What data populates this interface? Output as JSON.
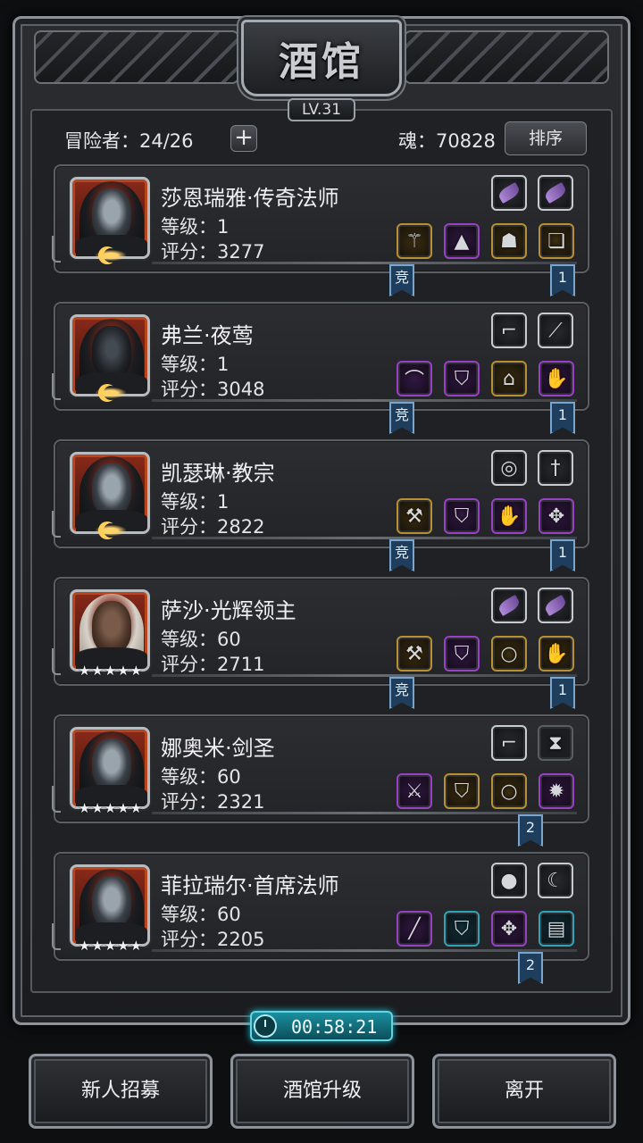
{
  "title": "酒馆",
  "level_badge": "LV.31",
  "header": {
    "adventurers": "冒险者：24/26",
    "plus": "+",
    "soul": "魂：70828",
    "sort_label": "排序"
  },
  "heroes": [
    {
      "name": "莎恩瑞雅·传奇法师",
      "level": "等级：1",
      "score": "评分：3277",
      "rank_marker": "moon",
      "portrait": "hooded-mage",
      "top_slots": [
        {
          "tier": "white",
          "icon": "gem-icon"
        },
        {
          "tier": "white",
          "icon": "gem-icon"
        }
      ],
      "bottom_slots": [
        {
          "tier": "gold",
          "icon": "staff-icon"
        },
        {
          "tier": "purple",
          "icon": "hat-icon"
        },
        {
          "tier": "gold",
          "icon": "mask-icon"
        },
        {
          "tier": "gold",
          "icon": "scroll-icon"
        }
      ],
      "tags": [
        {
          "text": "竞"
        },
        {
          "text": "1"
        }
      ]
    },
    {
      "name": "弗兰·夜莺",
      "level": "等级：1",
      "score": "评分：3048",
      "rank_marker": "moon",
      "portrait": "masked-knight",
      "top_slots": [
        {
          "tier": "white",
          "icon": "boot-icon"
        },
        {
          "tier": "white",
          "icon": "feather-icon"
        }
      ],
      "bottom_slots": [
        {
          "tier": "purple",
          "icon": "blade-icon"
        },
        {
          "tier": "purple",
          "icon": "armor-icon"
        },
        {
          "tier": "gold",
          "icon": "cloak-icon"
        },
        {
          "tier": "purple",
          "icon": "gauntlet-icon"
        }
      ],
      "tags": [
        {
          "text": "竞"
        },
        {
          "text": "1"
        }
      ]
    },
    {
      "name": "凯瑟琳·教宗",
      "level": "等级：1",
      "score": "评分：2822",
      "rank_marker": "moon",
      "portrait": "nun",
      "top_slots": [
        {
          "tier": "white",
          "icon": "charm-icon"
        },
        {
          "tier": "white",
          "icon": "dagger-icon"
        }
      ],
      "bottom_slots": [
        {
          "tier": "gold",
          "icon": "hammer-icon"
        },
        {
          "tier": "purple",
          "icon": "armor-icon"
        },
        {
          "tier": "purple",
          "icon": "gauntlet-icon"
        },
        {
          "tier": "purple",
          "icon": "amulet-icon"
        }
      ],
      "tags": [
        {
          "text": "竞"
        },
        {
          "text": "1"
        }
      ]
    },
    {
      "name": "萨沙·光辉领主",
      "level": "等级：60",
      "score": "评分：2711",
      "rank_marker": "stars",
      "stars": "★★★★★",
      "portrait": "light-lord",
      "top_slots": [
        {
          "tier": "white",
          "icon": "gem-icon"
        },
        {
          "tier": "white",
          "icon": "gem-icon"
        }
      ],
      "bottom_slots": [
        {
          "tier": "gold",
          "icon": "hammer-icon"
        },
        {
          "tier": "purple",
          "icon": "armor-icon"
        },
        {
          "tier": "gold",
          "icon": "ring-icon"
        },
        {
          "tier": "gold",
          "icon": "gauntlet-icon"
        }
      ],
      "tags": [
        {
          "text": "竞"
        },
        {
          "text": "1"
        }
      ]
    },
    {
      "name": "娜奥米·剑圣",
      "level": "等级：60",
      "score": "评分：2321",
      "rank_marker": "stars",
      "stars": "★★★★★",
      "portrait": "hooded-swordmaster",
      "top_slots": [
        {
          "tier": "white",
          "icon": "boot-icon"
        },
        {
          "tier": "empty",
          "icon": "empty-slot-icon"
        }
      ],
      "bottom_slots": [
        {
          "tier": "purple",
          "icon": "sword-icon"
        },
        {
          "tier": "gold",
          "icon": "armor-icon"
        },
        {
          "tier": "gold",
          "icon": "ring-icon"
        },
        {
          "tier": "purple",
          "icon": "flame-amulet-icon"
        }
      ],
      "tags": [
        {
          "text": "2"
        }
      ]
    },
    {
      "name": "菲拉瑞尔·首席法师",
      "level": "等级：60",
      "score": "评分：2205",
      "rank_marker": "stars",
      "stars": "★★★★★",
      "portrait": "hooded-mage",
      "top_slots": [
        {
          "tier": "white",
          "icon": "orb-icon"
        },
        {
          "tier": "white",
          "icon": "claw-icon"
        }
      ],
      "bottom_slots": [
        {
          "tier": "purple",
          "icon": "wand-icon"
        },
        {
          "tier": "cyan",
          "icon": "armor-icon"
        },
        {
          "tier": "purple",
          "icon": "amulet-icon"
        },
        {
          "tier": "cyan",
          "icon": "barrel-icon"
        }
      ],
      "tags": [
        {
          "text": "2"
        }
      ]
    }
  ],
  "timer": "00:58:21",
  "buttons": {
    "recruit": "新人招募",
    "upgrade": "酒馆升级",
    "leave": "离开"
  },
  "colors": {
    "gold_tier": "#b9902f",
    "purple_tier": "#9a3fc7",
    "cyan_tier": "#2fa3b8",
    "tag_blue": "#1f3d5c",
    "timer_teal": "#1a8fa0"
  }
}
